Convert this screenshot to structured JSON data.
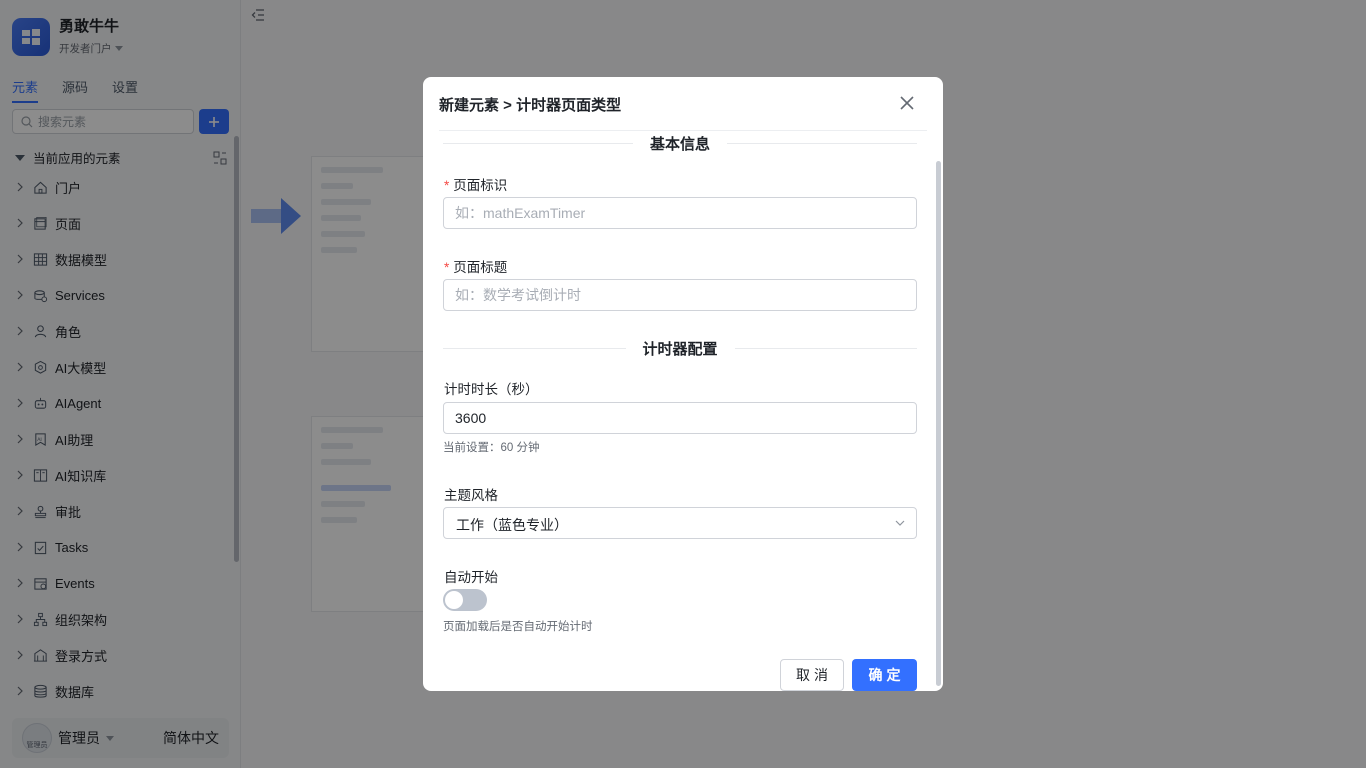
{
  "app": {
    "name": "勇敢牛牛",
    "subtitle": "开发者门户"
  },
  "tabs": [
    {
      "label": "元素",
      "active": true
    },
    {
      "label": "源码",
      "active": false
    },
    {
      "label": "设置",
      "active": false
    }
  ],
  "search": {
    "placeholder": "搜索元素"
  },
  "tree": {
    "section_label": "当前应用的元素",
    "items": [
      {
        "label": "门户",
        "icon": "home-icon"
      },
      {
        "label": "页面",
        "icon": "page-icon"
      },
      {
        "label": "数据模型",
        "icon": "table-icon"
      },
      {
        "label": "Services",
        "icon": "database-icon"
      },
      {
        "label": "角色",
        "icon": "role-icon"
      },
      {
        "label": "AI大模型",
        "icon": "hexagon-icon"
      },
      {
        "label": "AIAgent",
        "icon": "robot-icon"
      },
      {
        "label": "AI助理",
        "icon": "ai-assistant-icon"
      },
      {
        "label": "AI知识库",
        "icon": "book-icon"
      },
      {
        "label": "审批",
        "icon": "stamp-icon"
      },
      {
        "label": "Tasks",
        "icon": "clipboard-icon"
      },
      {
        "label": "Events",
        "icon": "calendar-icon"
      },
      {
        "label": "组织架构",
        "icon": "org-icon"
      },
      {
        "label": "登录方式",
        "icon": "building-icon"
      },
      {
        "label": "数据库",
        "icon": "db-stack-icon"
      }
    ]
  },
  "user": {
    "name": "管理员",
    "avatar_text": "管理员",
    "language": "简体中文"
  },
  "colors": {
    "primary": "#3370ff",
    "required": "#f54a45"
  },
  "modal": {
    "title": "新建元素 > 计时器页面类型",
    "section_basic": "基本信息",
    "page_id": {
      "label": "页面标识",
      "placeholder": "如：mathExamTimer",
      "value": ""
    },
    "page_title": {
      "label": "页面标题",
      "placeholder": "如：数学考试倒计时",
      "value": ""
    },
    "section_timer": "计时器配置",
    "duration": {
      "label": "计时时长（秒）",
      "value": "3600",
      "hint": "当前设置：60 分钟"
    },
    "theme": {
      "label": "主题风格",
      "value": "工作（蓝色专业）"
    },
    "auto_start": {
      "label": "自动开始",
      "enabled": false,
      "hint": "页面加载后是否自动开始计时"
    },
    "cancel_label": "取消",
    "ok_label": "确定"
  }
}
